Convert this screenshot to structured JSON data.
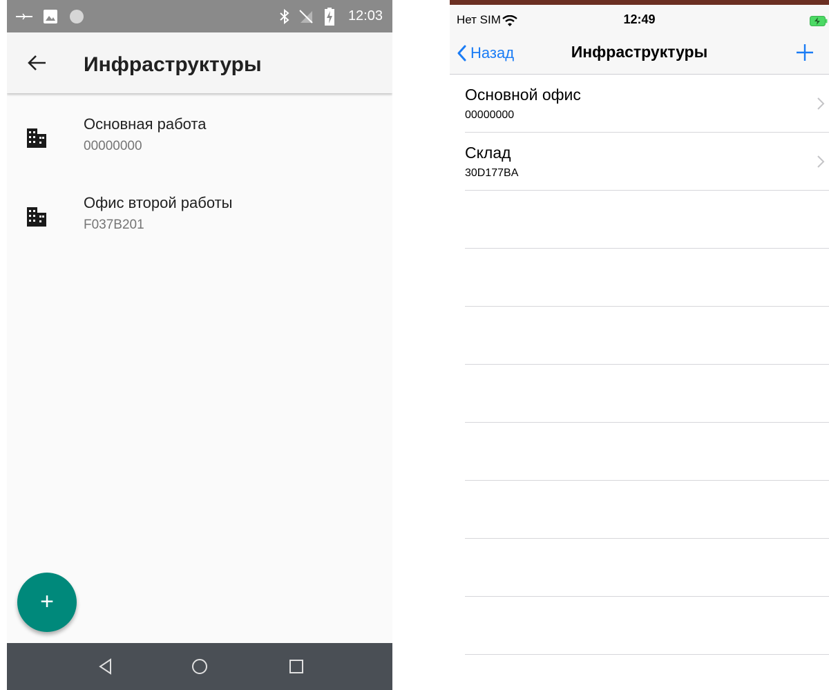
{
  "android": {
    "status_time": "12:03",
    "title": "Инфраструктуры",
    "items": [
      {
        "name": "Основная работа",
        "code": "00000000"
      },
      {
        "name": "Офис второй работы",
        "code": "F037B201"
      }
    ],
    "fab_label": "+",
    "accent": "#00897b"
  },
  "ios": {
    "carrier": "Нет SIM",
    "time": "12:49",
    "back_label": "Назад",
    "title": "Инфраструктуры",
    "rows": [
      {
        "name": "Основной офис",
        "code": "00000000"
      },
      {
        "name": "Склад",
        "code": "30D177BA"
      }
    ],
    "tint": "#1a7cf5"
  }
}
